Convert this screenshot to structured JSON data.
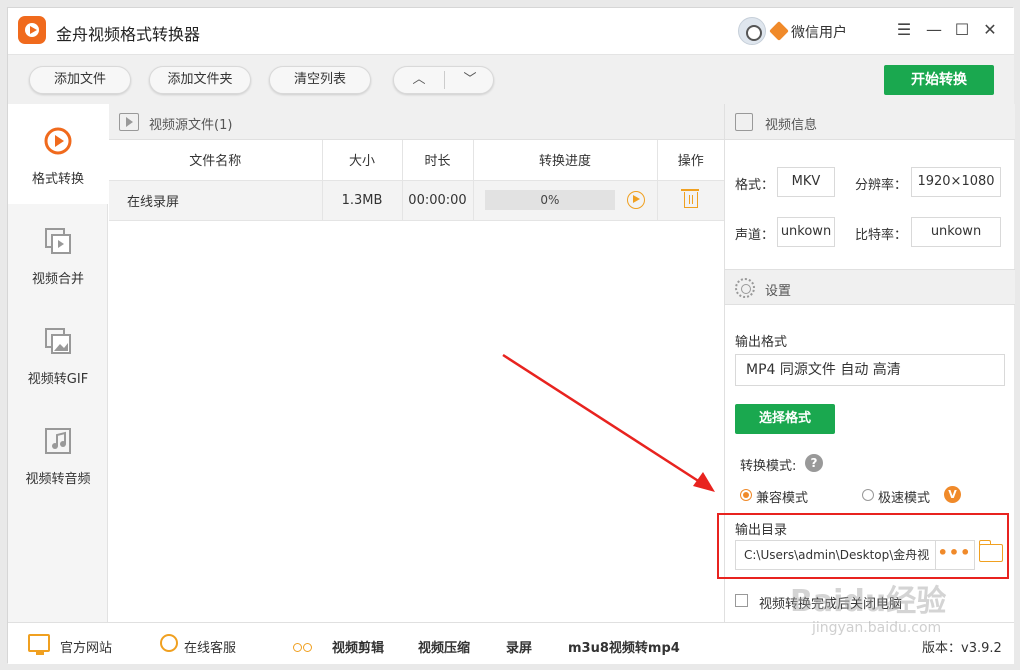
{
  "app": {
    "title": "金舟视频格式转换器",
    "user_name": "微信用户"
  },
  "window_controls": {
    "menu": "☰",
    "minimize": "—",
    "maximize": "☐",
    "close": "✕"
  },
  "toolbar": {
    "add_file": "添加文件",
    "add_folder": "添加文件夹",
    "clear_list": "清空列表",
    "move_up": "︿",
    "move_down": "﹀",
    "start_convert": "开始转换"
  },
  "sidebar": {
    "items": [
      {
        "label": "格式转换",
        "icon": "play-circle-icon",
        "active": true
      },
      {
        "label": "视频合并",
        "icon": "merge-icon",
        "active": false
      },
      {
        "label": "视频转GIF",
        "icon": "image-icon",
        "active": false
      },
      {
        "label": "视频转音频",
        "icon": "music-icon",
        "active": false
      }
    ]
  },
  "file_panel": {
    "title": "视频源文件(1)",
    "columns": [
      "文件名称",
      "大小",
      "时长",
      "转换进度",
      "操作"
    ],
    "rows": [
      {
        "name": "在线录屏",
        "size": "1.3MB",
        "duration": "00:00:00",
        "progress_text": "0%",
        "progress": 0
      }
    ]
  },
  "video_info": {
    "title": "视频信息",
    "format_label": "格式：",
    "format_value": "MKV",
    "resolution_label": "分辨率：",
    "resolution_value": "1920×1080",
    "channel_label": "声道：",
    "channel_value": "unkown",
    "bitrate_label": "比特率：",
    "bitrate_value": "unkown"
  },
  "settings": {
    "title": "设置",
    "output_format_label": "输出格式",
    "output_format_value": "MP4 同源文件 自动 高清",
    "select_format_button": "选择格式",
    "mode_label": "转换模式:",
    "help": "?",
    "mode_compatible": "兼容模式",
    "mode_fast": "极速模式",
    "vip_badge": "V",
    "output_dir_label": "输出目录",
    "output_dir_value": "C:\\Users\\admin\\Desktop\\金舟视",
    "more_dots": "•••",
    "shutdown_label": "视频转换完成后关闭电脑"
  },
  "footer": {
    "website": "官方网站",
    "service": "在线客服",
    "edit": "视频剪辑",
    "compress": "视频压缩",
    "record": "录屏",
    "m3u8": "m3u8视频转mp4",
    "version": "版本：v3.9.2"
  },
  "watermark": {
    "main": "Baidu经验",
    "sub": "jingyan.baidu.com"
  },
  "colors": {
    "accent_green": "#1aa84f",
    "accent_orange": "#f08a2a",
    "highlight_red": "#e8231f"
  }
}
